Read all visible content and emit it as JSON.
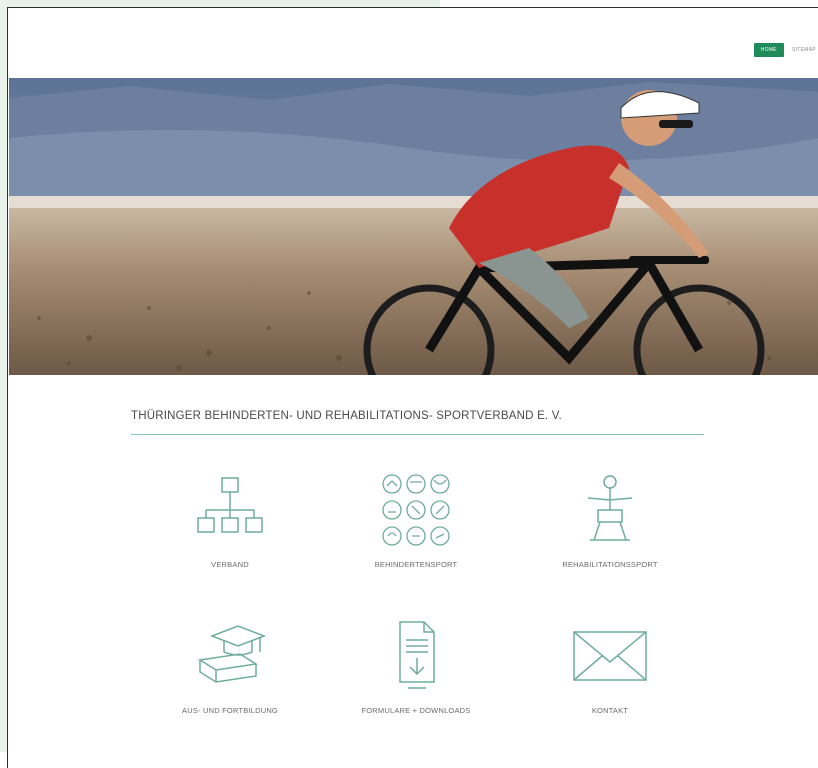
{
  "nav": {
    "home_label": "HOME",
    "second_label": "SITEMAP"
  },
  "hero": {
    "image_subject": "cyclist-with-prosthetic-leg"
  },
  "organization_title": "THÜRINGER BEHINDERTEN- UND REHABILITATIONS- SPORTVERBAND E. V.",
  "tiles": [
    {
      "label": "VERBAND",
      "icon": "org-chart-icon"
    },
    {
      "label": "BEHINDERTENSPORT",
      "icon": "sports-grid-icon"
    },
    {
      "label": "REHABILITATIONSSPORT",
      "icon": "rehab-figure-icon"
    },
    {
      "label": "AUS- UND FORTBILDUNG",
      "icon": "graduation-books-icon"
    },
    {
      "label": "FORMULARE + DOWNLOADS",
      "icon": "document-download-icon"
    },
    {
      "label": "KONTAKT",
      "icon": "envelope-icon"
    }
  ],
  "colors": {
    "accent_green": "#1f8a5a",
    "icon_stroke": "#6fae96",
    "rule_green": "#8fc9b0",
    "backdrop": "#e9f3ec"
  }
}
